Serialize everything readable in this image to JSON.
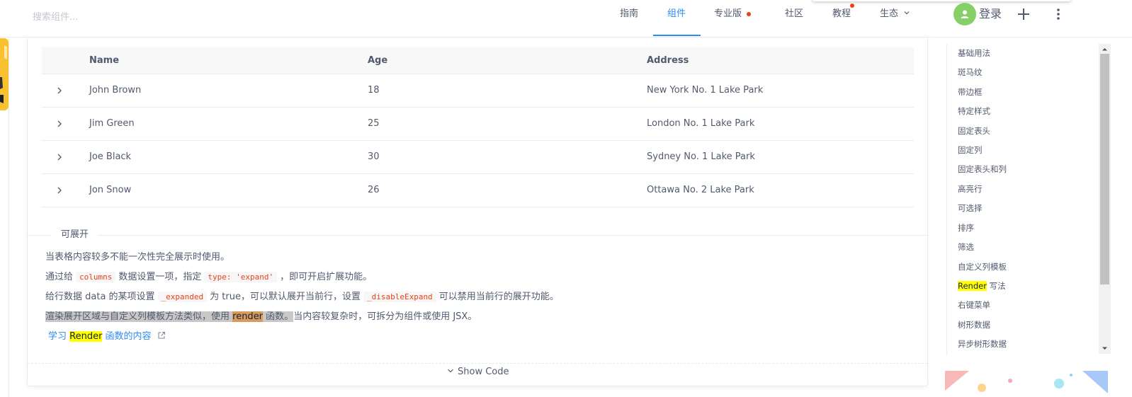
{
  "header": {
    "search_placeholder": "搜索组件...",
    "nav": [
      {
        "label": "指南"
      },
      {
        "label": "组件"
      },
      {
        "label": "专业版"
      },
      {
        "label": "社区"
      },
      {
        "label": "教程"
      },
      {
        "label": "生态"
      }
    ],
    "login_label": "登录"
  },
  "table": {
    "columns": [
      "Name",
      "Age",
      "Address"
    ],
    "rows": [
      {
        "name": "John Brown",
        "age": "18",
        "address": "New York No. 1 Lake Park"
      },
      {
        "name": "Jim Green",
        "age": "25",
        "address": "London No. 1 Lake Park"
      },
      {
        "name": "Joe Black",
        "age": "30",
        "address": "Sydney No. 1 Lake Park"
      },
      {
        "name": "Jon Snow",
        "age": "26",
        "address": "Ottawa No. 2 Lake Park"
      }
    ]
  },
  "section": {
    "title": "可展开",
    "p1": "当表格内容较多不能一次性完全展示时使用。",
    "p2": {
      "a": "通过给",
      "code1": "columns",
      "b": "数据设置一项，指定",
      "code2": "type: 'expand'",
      "c": "，即可开启扩展功能。"
    },
    "p3": {
      "a": "给行数据 data 的某项设置",
      "code1": "_expanded",
      "b": "为 true，可以默认展开当前行，设置",
      "code2": "_disableExpand",
      "c": "可以禁用当前行的展开功能。"
    },
    "p4": {
      "a": "渲染展开区域与自定义列模板方法类似，使用 ",
      "hl": "render",
      "b": " 函数。",
      "c": "当内容较复杂时，可拆分为组件或使用 JSX。"
    },
    "link": {
      "a": "学习 ",
      "hl": "Render",
      "b": " 函数的内容"
    }
  },
  "show_code_label": "Show Code",
  "anchors": [
    {
      "label": "基础用法"
    },
    {
      "label": "斑马纹"
    },
    {
      "label": "带边框"
    },
    {
      "label": "特定样式"
    },
    {
      "label": "固定表头"
    },
    {
      "label": "固定列"
    },
    {
      "label": "固定表头和列"
    },
    {
      "label": "高亮行"
    },
    {
      "label": "可选择"
    },
    {
      "label": "排序"
    },
    {
      "label": "筛选"
    },
    {
      "label": "自定义列模板"
    },
    {
      "label": "写法",
      "hl": "Render"
    },
    {
      "label": "右键菜单"
    },
    {
      "label": "树形数据"
    },
    {
      "label": "异步树形数据"
    }
  ],
  "colors": {
    "accent": "#2d8cf0",
    "highlight": "#ffff00",
    "avatar": "#87d068",
    "dot": "#ed4014"
  }
}
